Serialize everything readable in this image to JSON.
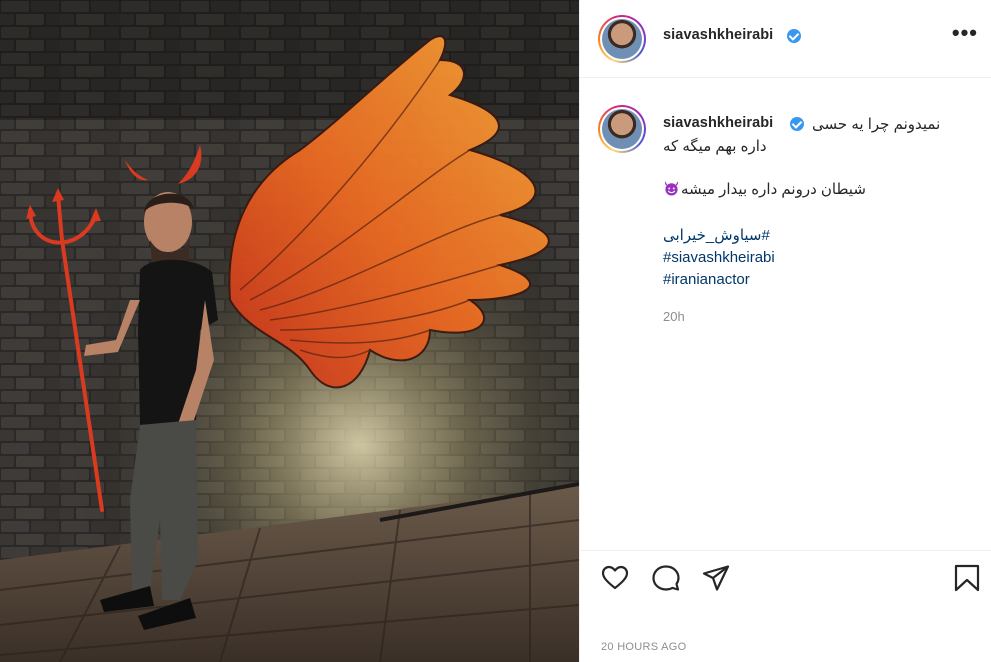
{
  "post": {
    "author": {
      "username": "siavashkheirabi",
      "verified": true
    },
    "caption": {
      "line1": "نمیدونم چرا یه حسی",
      "line2": "داره بهم میگه که",
      "line3": "شیطان درونم داره بیدار میشه",
      "line3_emoji": "smiling-devil-emoji",
      "hashtags": [
        "#سیاوش_خیرابی",
        "#siavashkheirabi",
        "#iranianactor"
      ]
    },
    "relative_time": "20h",
    "timestamp": "20 HOURS AGO"
  },
  "icons": {
    "more": "more-options-icon",
    "like": "heart-icon",
    "comment": "comment-icon",
    "share": "share-paper-plane-icon",
    "save": "bookmark-icon"
  },
  "colors": {
    "text": "#262626",
    "hashtag": "#00376b",
    "muted": "#8e8e8e",
    "verified": "#3897f0",
    "divider": "#efefef"
  }
}
